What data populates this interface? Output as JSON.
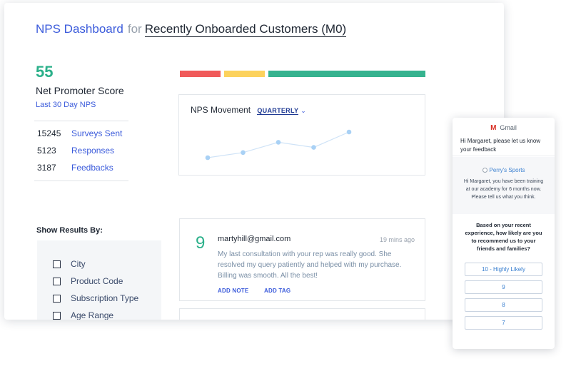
{
  "header": {
    "title": "NPS Dashboard",
    "for_word": "for",
    "segment": "Recently Onboarded Customers (M0)"
  },
  "score": {
    "value": "55",
    "label": "Net Promoter Score",
    "sub": "Last 30 Day NPS"
  },
  "stats": [
    {
      "value": "15245",
      "label": "Surveys Sent"
    },
    {
      "value": "5123",
      "label": "Responses"
    },
    {
      "value": "3187",
      "label": "Feedbacks"
    }
  ],
  "distribution_bar": [
    {
      "name": "detractors",
      "color": "#f05a5a",
      "fraction": 0.17
    },
    {
      "name": "passives",
      "color": "#fcd25d",
      "fraction": 0.17
    },
    {
      "name": "promoters",
      "color": "#36b38f",
      "fraction": 0.66
    }
  ],
  "movement": {
    "title": "NPS Movement",
    "period": "QUARTERLY",
    "chart_data": {
      "type": "line",
      "values": [
        1,
        2,
        4,
        3,
        6
      ],
      "color": "#a9d1f5",
      "grid": false
    }
  },
  "filters": {
    "title": "Show Results By:",
    "items": [
      "City",
      "Product Code",
      "Subscription Type",
      "Age Range"
    ]
  },
  "feedback": {
    "score": "9",
    "email": "martyhill@gmail.com",
    "time": "19 mins ago",
    "text": "My last consultation with your rep was really good. She resolved my query patiently and helped with my purchase. Billing was smooth. All the best!",
    "add_note": "ADD NOTE",
    "add_tag": "ADD TAG"
  },
  "email_preview": {
    "app": "Gmail",
    "logo": "M",
    "greeting": "Hi Margaret, please let us know your feedback",
    "store": "Perry's Sports",
    "message": "Hi Margaret, you have been training at our academy for 6 months now. Please tell us what you think.",
    "question": "Based on your recent experience, how likely are you to recommend us to your friends and families?",
    "options": [
      "10 - Highly Likely",
      "9",
      "8",
      "7"
    ]
  }
}
